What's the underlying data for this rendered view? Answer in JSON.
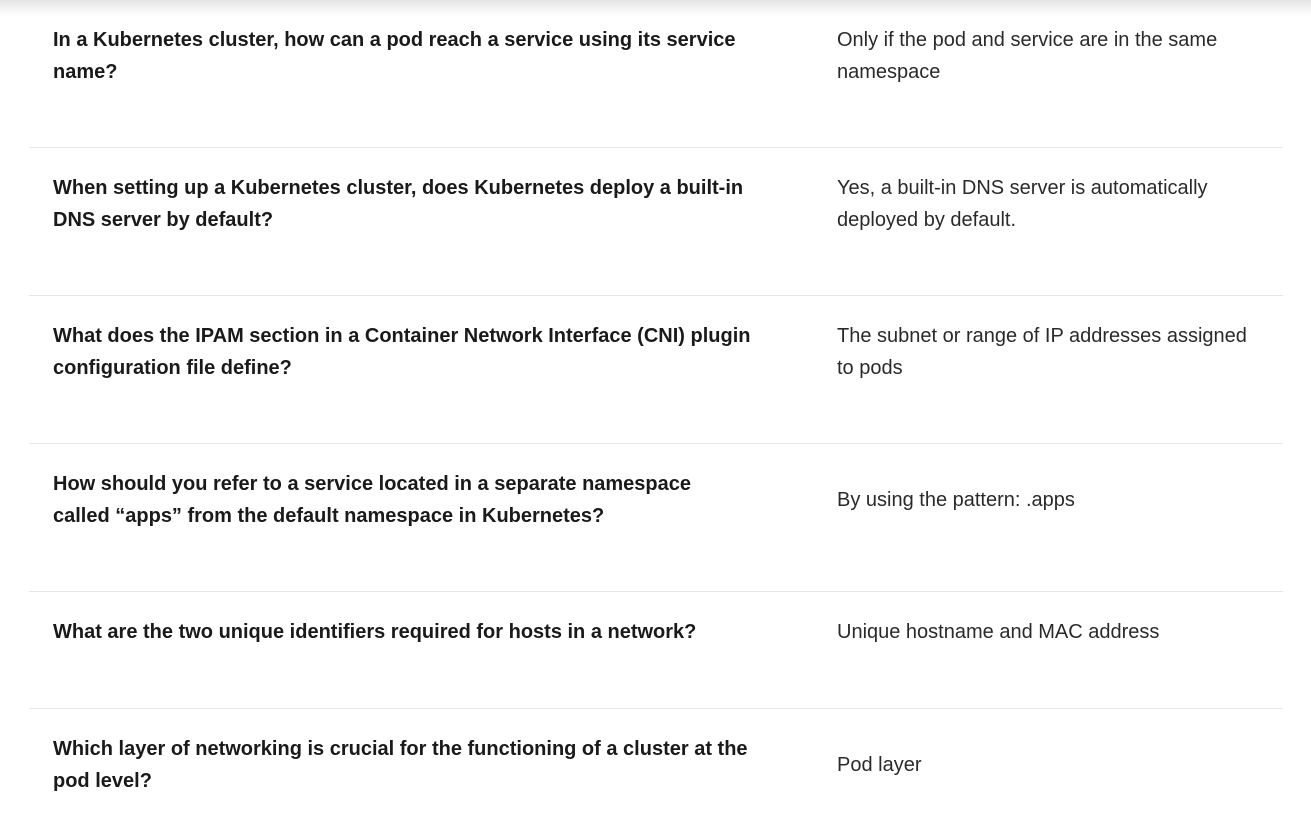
{
  "faq": {
    "items": [
      {
        "question": "In a Kubernetes cluster, how can a pod reach a service using its service name?",
        "answer": "Only if the pod and service are in the same namespace"
      },
      {
        "question": "When setting up a Kubernetes cluster, does Kubernetes deploy a built-in DNS server by default?",
        "answer": "Yes, a built-in DNS server is automatically deployed by default."
      },
      {
        "question": "What does the IPAM section in a Container Network Interface (CNI) plugin configuration file define?",
        "answer": "The subnet or range of IP addresses assigned to pods"
      },
      {
        "question": "How should you refer to a service located in a separate namespace called “apps” from the default namespace in Kubernetes?",
        "answer": "By using the pattern: .apps"
      },
      {
        "question": "What are the two unique identifiers required for hosts in a network?",
        "answer": "Unique hostname and MAC address"
      },
      {
        "question": "Which layer of networking is crucial for the functioning of a cluster at the pod level?",
        "answer": "Pod layer"
      }
    ]
  }
}
